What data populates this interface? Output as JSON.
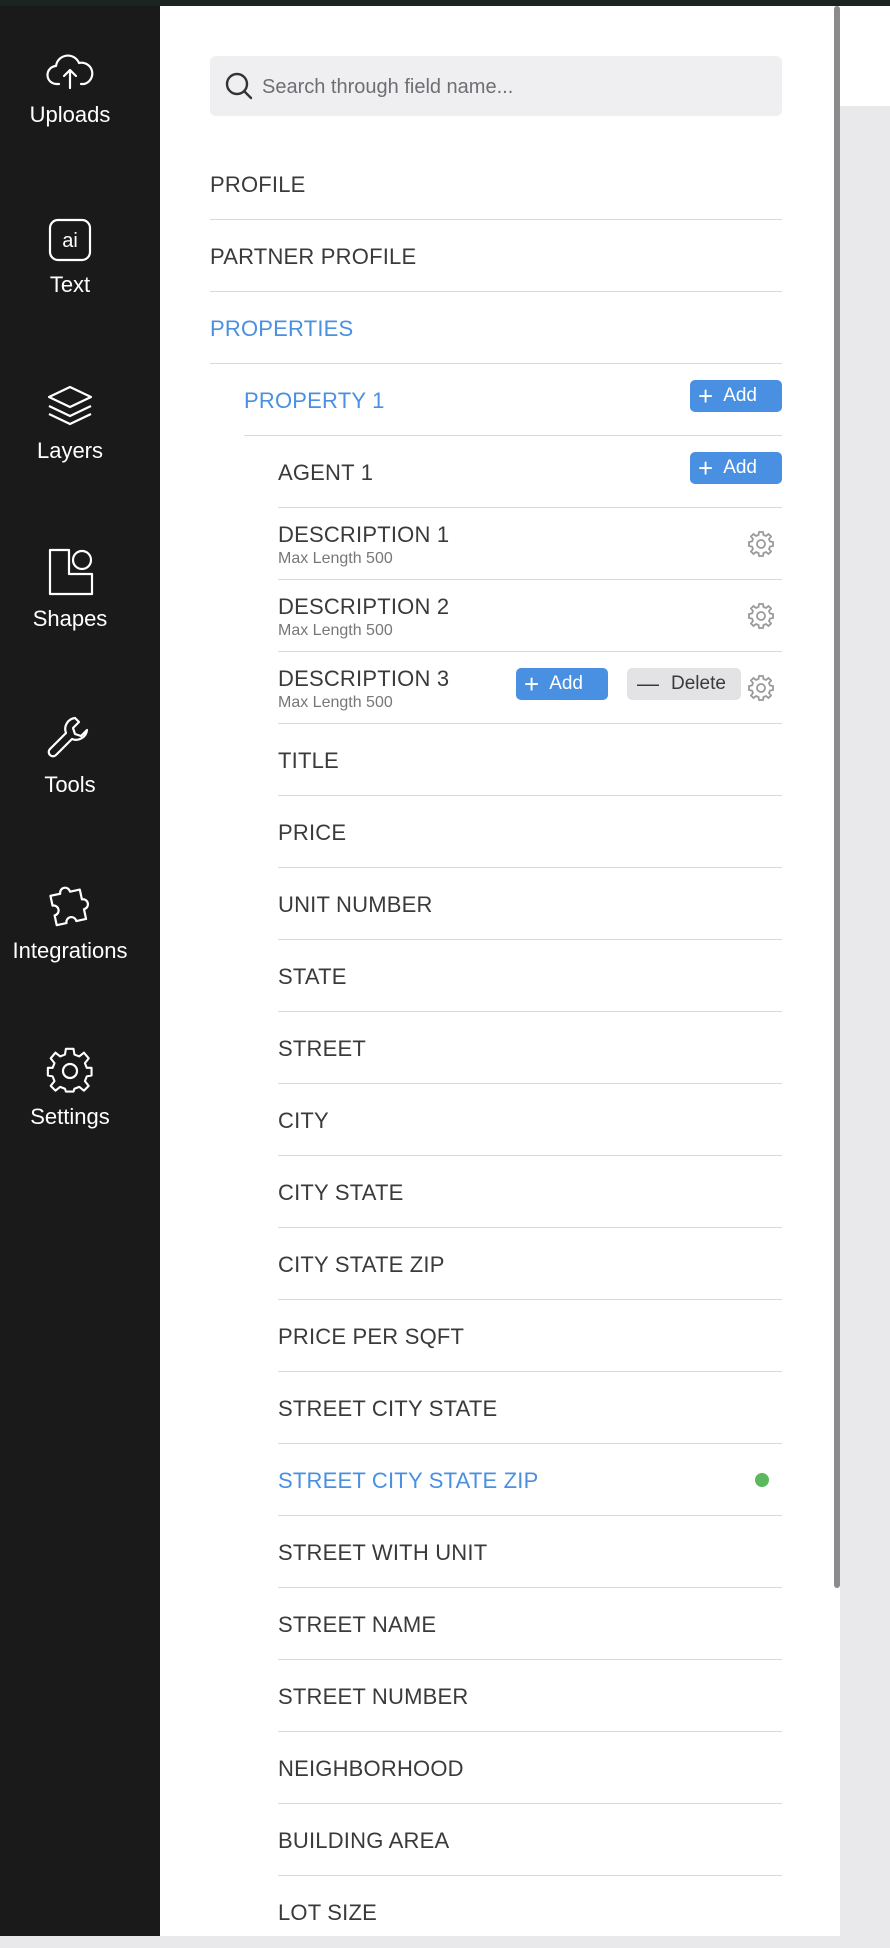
{
  "sidebar": {
    "items": [
      {
        "label": "Uploads",
        "icon": "cloud-upload-icon"
      },
      {
        "label": "Text",
        "icon": "ai-text-icon",
        "icon_text": "ai"
      },
      {
        "label": "Layers",
        "icon": "layers-icon"
      },
      {
        "label": "Shapes",
        "icon": "shapes-icon"
      },
      {
        "label": "Tools",
        "icon": "wrench-icon"
      },
      {
        "label": "Integrations",
        "icon": "puzzle-icon"
      },
      {
        "label": "Settings",
        "icon": "gear-icon"
      }
    ]
  },
  "search": {
    "placeholder": "Search through field name..."
  },
  "sections": {
    "profile": "PROFILE",
    "partner_profile": "PARTNER PROFILE",
    "properties": "PROPERTIES",
    "property_1": "PROPERTY 1",
    "agent_1": "AGENT 1"
  },
  "descriptions": [
    {
      "label": "DESCRIPTION 1",
      "sub": "Max Length 500"
    },
    {
      "label": "DESCRIPTION 2",
      "sub": "Max Length 500"
    },
    {
      "label": "DESCRIPTION 3",
      "sub": "Max Length 500"
    }
  ],
  "buttons": {
    "add": "Add",
    "delete": "Delete"
  },
  "fields": [
    "TITLE",
    "PRICE",
    "UNIT NUMBER",
    "STATE",
    "STREET",
    "CITY",
    "CITY STATE",
    "CITY STATE ZIP",
    "PRICE PER SQFT",
    "STREET CITY STATE",
    "STREET CITY STATE ZIP",
    "STREET WITH UNIT",
    "STREET NAME",
    "STREET NUMBER",
    "NEIGHBORHOOD",
    "BUILDING AREA",
    "LOT SIZE"
  ],
  "active_field": "STREET CITY STATE ZIP",
  "colors": {
    "accent": "#4a90e2",
    "active_dot": "#5cb85c",
    "rail": "#1a1a1a"
  }
}
